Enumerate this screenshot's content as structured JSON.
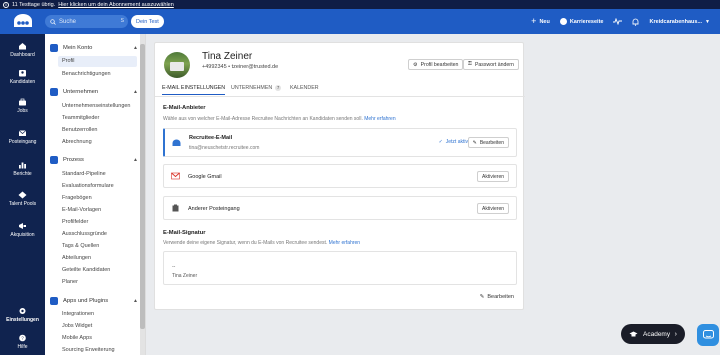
{
  "trial_bar": {
    "text": "11 Testtage übrig.",
    "link": "Hier klicken um dein Abonnement auszuwählen"
  },
  "topbar": {
    "search_placeholder": "Suche",
    "search_shortcut": "S",
    "context_label": "Dein Test",
    "new_label": "Neu",
    "career_label": "Karriereseite",
    "company_label": "Kreidcarabenhaus...",
    "accent_color": "#1f5cc4"
  },
  "leftnav": {
    "items": [
      {
        "label": "Dashboard",
        "icon": "home-icon"
      },
      {
        "label": "Kandidaten",
        "icon": "people-icon"
      },
      {
        "label": "Jobs",
        "icon": "briefcase-icon"
      },
      {
        "label": "Posteingang",
        "icon": "envelope-icon"
      },
      {
        "label": "Berichte",
        "icon": "bar-chart-icon"
      },
      {
        "label": "Talent Pools",
        "icon": "talent-pool-icon"
      },
      {
        "label": "Akquisition",
        "icon": "megaphone-icon"
      },
      {
        "label": "Einstellungen",
        "icon": "gear-icon"
      },
      {
        "label": "Hilfe",
        "icon": "help-icon"
      }
    ]
  },
  "subnav": {
    "sections": [
      {
        "title": "Mein Konto",
        "items": [
          "Profil",
          "Benachrichtigungen"
        ]
      },
      {
        "title": "Unternehmen",
        "items": [
          "Unternehmenseinstellungen",
          "Teammitglieder",
          "Benutzerrollen",
          "Abrechnung"
        ]
      },
      {
        "title": "Prozess",
        "items": [
          "Standard-Pipeline",
          "Evaluationsformulare",
          "Fragebögen",
          "E-Mail-Vorlagen",
          "Profilfelder",
          "Ausschlussgründe",
          "Tags & Quellen",
          "Abteilungen",
          "Geteilte Kandidaten",
          "Planer"
        ]
      },
      {
        "title": "Apps und Plugins",
        "items": [
          "Integrationen",
          "Jobs Widget",
          "Mobile Apps",
          "Sourcing Erweiterung"
        ]
      }
    ],
    "active_item": "Profil"
  },
  "profile": {
    "name": "Tina Zeiner",
    "phone": "+4992345",
    "email": "tzeiner@trusted.de",
    "edit_profile_label": "Profil bearbeiten",
    "change_password_label": "Passwort ändern"
  },
  "tabs": [
    {
      "label": "E-MAIL EINSTELLUNGEN",
      "count": null
    },
    {
      "label": "UNTERNEHMEN",
      "count": "7"
    },
    {
      "label": "KALENDER",
      "count": null
    }
  ],
  "email_provider": {
    "heading": "E-Mail-Anbieter",
    "description": "Wähle aus von welcher E-Mail-Adresse Recruitee Nachrichten an Kandidaten senden soll.",
    "learn_more": "Mehr erfahren",
    "providers": [
      {
        "title": "Recruitee-E-Mail",
        "address": "tina@neuschetstr.recruitee.com",
        "status": "Jetzt aktiv",
        "action": "Bearbeiten",
        "icon": "recruitee-logo-icon"
      },
      {
        "title": "Google Gmail",
        "action": "Aktivieren",
        "icon": "gmail-icon"
      },
      {
        "title": "Anderer Posteingang",
        "action": "Aktivieren",
        "icon": "inbox-icon"
      }
    ]
  },
  "signature": {
    "heading": "E-Mail-Signatur",
    "description": "Verwende deine eigene Signatur, wenn du E-Mails von Recruitee sendest.",
    "learn_more": "Mehr erfahren",
    "line1": "--",
    "line2": "Tina Zeiner",
    "edit_label": "Bearbeiten"
  },
  "academy": {
    "label": "Academy"
  }
}
